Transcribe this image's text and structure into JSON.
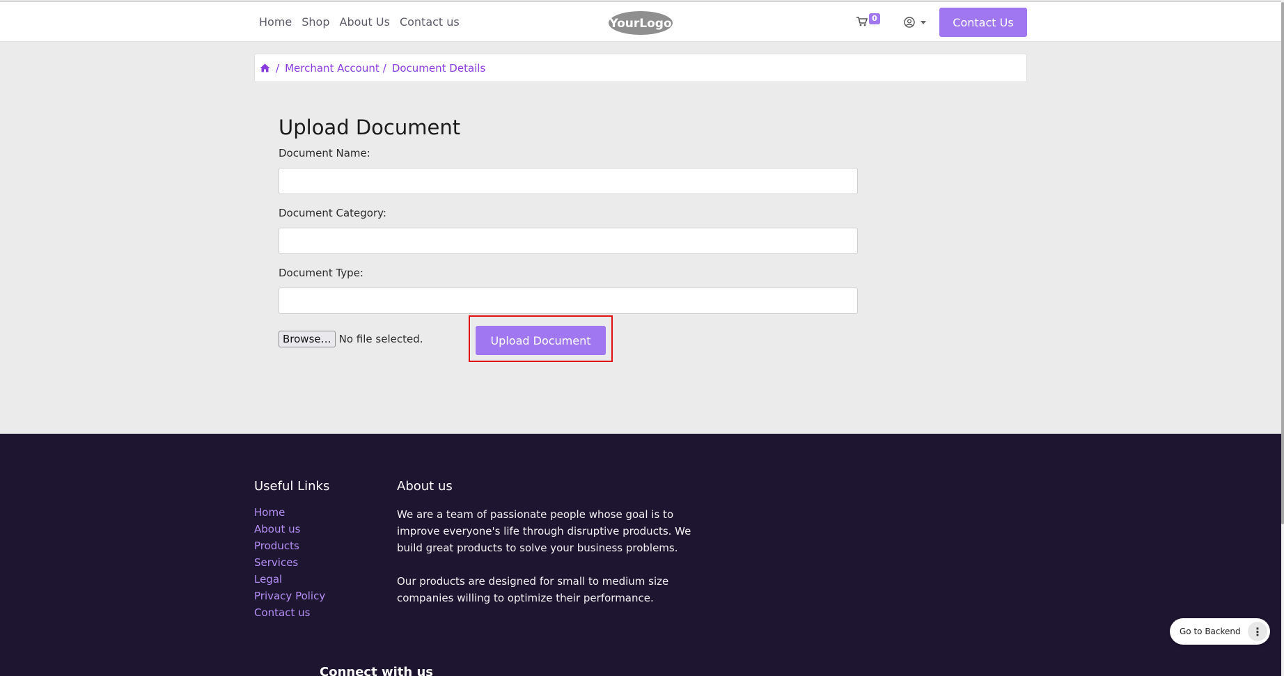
{
  "nav": {
    "items": [
      "Home",
      "Shop",
      "About Us",
      "Contact us"
    ],
    "logo_text": "YourLogo",
    "cart_count": "0",
    "contact_button": "Contact Us"
  },
  "breadcrumb": {
    "items": [
      "Merchant Account",
      "Document Details"
    ]
  },
  "form": {
    "title": "Upload Document",
    "name_label": "Document Name:",
    "category_label": "Document Category:",
    "type_label": "Document Type:",
    "browse_label": "Browse…",
    "file_status": "No file selected.",
    "upload_button": "Upload Document"
  },
  "footer": {
    "useful_links_title": "Useful Links",
    "links": [
      "Home",
      "About us",
      "Products",
      "Services",
      "Legal",
      "Privacy Policy",
      "Contact us"
    ],
    "about_title": "About us",
    "about_p1": "We are a team of passionate people whose goal is to improve everyone's life through disruptive products. We build great products to solve your business problems.",
    "about_p2": "Our products are designed for small to medium size companies willing to optimize their performance.",
    "connect_title": "Connect with us"
  },
  "backend_button": "Go to Backend",
  "colors": {
    "primary": "#a077f0",
    "link": "#8a3be0",
    "footer_bg": "#1e1530",
    "highlight": "#e01010"
  }
}
